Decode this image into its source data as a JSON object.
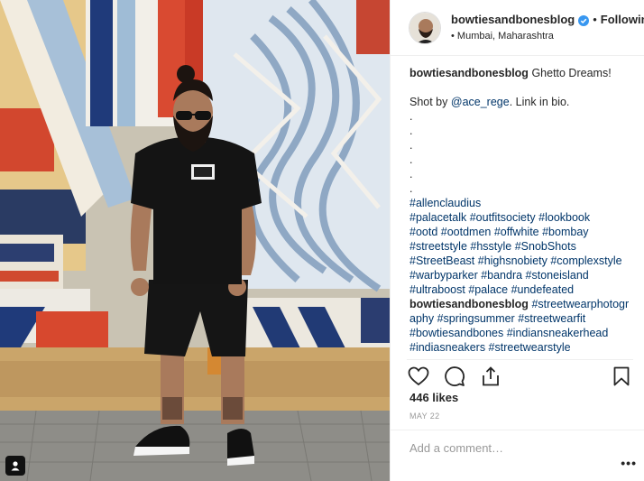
{
  "post": {
    "username": "bowtiesandbonesblog",
    "follow_state": "Following",
    "separator": "•",
    "location": "Mumbai, Maharashtra",
    "verified_icon": "verified-badge-icon",
    "caption": {
      "username": "bowtiesandbonesblog",
      "title": "Ghetto Dreams!",
      "credit_prefix": "Shot by ",
      "credit_mention": "@ace_rege",
      "credit_suffix": ". Link in bio.",
      "dots": [
        ".",
        ".",
        ".",
        ".",
        ".",
        "."
      ],
      "hashtag_lines": [
        "#allenclaudius",
        "#palacetalk #outfitsociety #lookbook",
        "#ootd #ootdmen #offwhite #bombay",
        "#streetstyle #hsstyle #SnobShots",
        "#StreetBeast #highsnobiety #complexstyle",
        "#warbyparker #bandra #stoneisland",
        "#ultraboost #palace #undefeated"
      ]
    },
    "comment2": {
      "username": "bowtiesandbonesblog",
      "first_tag": "#streetwearphotogr",
      "lines": [
        "aphy #springsummer #streetwearfit",
        "#bowtiesandbones #indiansneakerhead",
        "#indiasneakers #streetwearstyle"
      ]
    },
    "likes": "446 likes",
    "date": "MAY 22",
    "comment_placeholder": "Add a comment…",
    "more_label": "•••",
    "colors": {
      "link": "#003569",
      "verified": "#3897f0",
      "muted": "#999999",
      "text": "#262626"
    },
    "icons": [
      "heart-icon",
      "comment-icon",
      "share-icon",
      "bookmark-icon",
      "user-tag-icon"
    ]
  }
}
